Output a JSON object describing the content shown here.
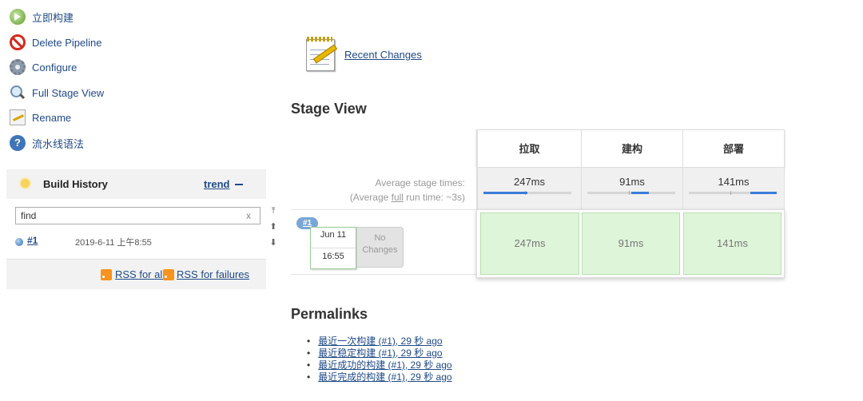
{
  "sidebar": {
    "tasks": [
      {
        "label": "立即构建",
        "icon": "build-now-icon"
      },
      {
        "label": "Delete Pipeline",
        "icon": "delete-icon"
      },
      {
        "label": "Configure",
        "icon": "gear-icon"
      },
      {
        "label": "Full Stage View",
        "icon": "search-icon"
      },
      {
        "label": "Rename",
        "icon": "rename-icon"
      },
      {
        "label": "流水线语法",
        "icon": "help-icon"
      }
    ]
  },
  "build_history": {
    "title": "Build History",
    "trend": "trend",
    "find_value": "find",
    "clear": "x",
    "builds": [
      {
        "number": "#1",
        "date": "2019-6-11 上午8:55"
      }
    ],
    "rss_all": "RSS for all",
    "rss_failures": "RSS for failures"
  },
  "main": {
    "recent_changes": "Recent Changes",
    "stage_view_title": "Stage View",
    "avg_label_1": "Average stage times:",
    "avg_label_2a": "(Average ",
    "avg_label_full": "full",
    "avg_label_2b": " run time: ~3s)",
    "stages": [
      {
        "name": "拉取",
        "avg": "247ms",
        "avg_fraction": 0.5,
        "run": "247ms"
      },
      {
        "name": "建构",
        "avg": "91ms",
        "avg_fraction": 0.2,
        "run": "91ms"
      },
      {
        "name": "部署",
        "avg": "141ms",
        "avg_fraction": 0.3,
        "run": "141ms"
      }
    ],
    "run": {
      "badge": "#1",
      "date": "Jun 11",
      "time": "16:55",
      "changes": "No Changes"
    },
    "permalinks_title": "Permalinks",
    "permalinks": [
      "最近一次构建 (#1), 29 秒 ago",
      "最近稳定构建 (#1), 29 秒 ago",
      "最近成功的构建 (#1), 29 秒 ago",
      "最近完成的构建 (#1), 29 秒 ago"
    ]
  },
  "colors": {
    "link": "#204a87",
    "stage_success_bg": "#dff5da",
    "bar_fill": "#3b7dd8"
  }
}
